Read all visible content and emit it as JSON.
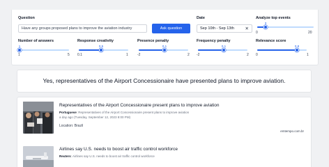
{
  "question": {
    "label": "Question",
    "value": "Have any groups proposed plans to improve the aviation industry",
    "button_label": "Ask question"
  },
  "date": {
    "label": "Date",
    "value": "Sep 10th - Sep 13th",
    "clear_icon": "close-icon"
  },
  "top_events": {
    "label": "Analyze top events",
    "min": "0",
    "max": "20",
    "value_label": "3",
    "fraction": 0.15
  },
  "sliders": [
    {
      "label": "Number of answers",
      "value_label": "1",
      "min": "1",
      "max": "5",
      "fraction": 0.0
    },
    {
      "label": "Response creativity",
      "value_label": "0.5",
      "min": "0.1",
      "max": "1",
      "fraction": 0.45
    },
    {
      "label": "Presence penalty",
      "value_label": "0.1",
      "min": "-2",
      "max": "2",
      "fraction": 0.52
    },
    {
      "label": "Frequency penalty",
      "value_label": "0.1",
      "min": "-2",
      "max": "2",
      "fraction": 0.52
    },
    {
      "label": "Relevance score",
      "value_label": "0.8",
      "min": "0",
      "max": "1",
      "fraction": 0.8
    }
  ],
  "answer": {
    "text": "Yes, representatives of the Airport Concessionaire have presented plans to improve aviation."
  },
  "results": [
    {
      "title": "Representatives of the Airport Concessionaire present plans to improve aviation",
      "meta_label": "Portuguese",
      "meta_text": "Representatives of the Airport Concessionaire present plans to improve aviation",
      "date": "a day ago (Tuesday, September 12, 2023 8:00 PM)",
      "location": "Location: Brazil",
      "source": "emtempo.com.br"
    },
    {
      "title": "Airlines say U.S. needs to boost air traffic control workforce",
      "meta_label": "Reuters",
      "meta_text": "Airlines say U.S. needs to boost air traffic control workforce"
    }
  ],
  "colors": {
    "accent": "#2563eb",
    "track": "#bfdbfe"
  }
}
